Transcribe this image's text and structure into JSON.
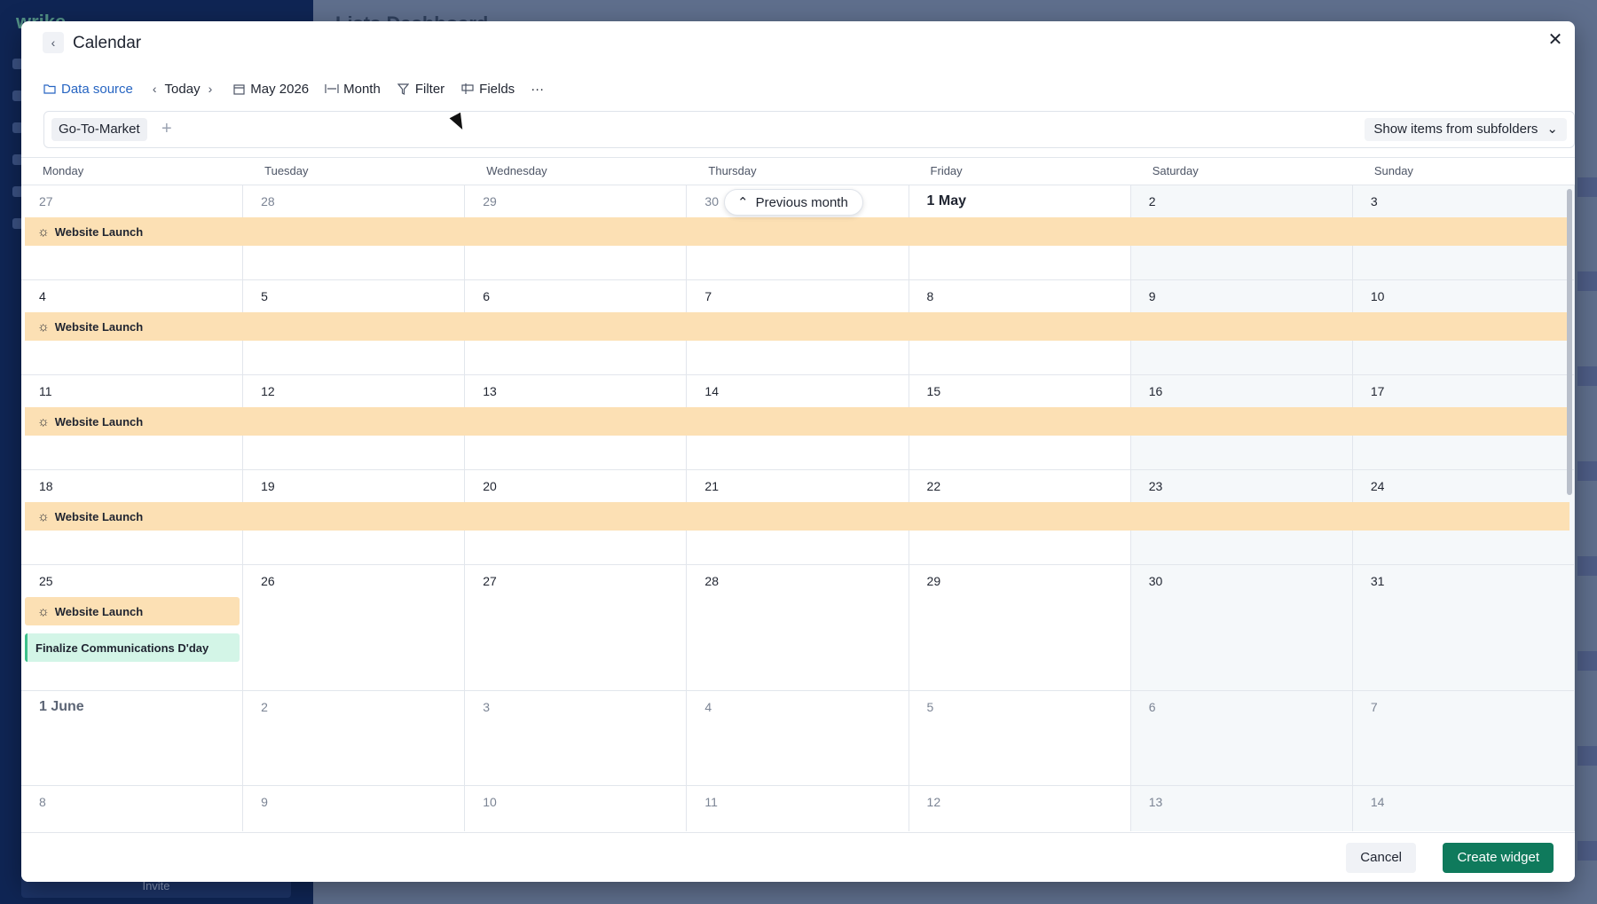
{
  "background": {
    "logo_text": "wrike",
    "page_title": "Lists Dashboard",
    "invite_label": "Invite"
  },
  "modal": {
    "title": "Calendar",
    "toolbar": {
      "data_source": "Data source",
      "today": "Today",
      "period": "May 2026",
      "view": "Month",
      "filter": "Filter",
      "fields": "Fields",
      "more": "···"
    },
    "folder_chip": "Go-To-Market",
    "subfolders_label": "Show items from subfolders",
    "prev_month_label": "Previous month",
    "cancel_label": "Cancel",
    "create_label": "Create widget"
  },
  "calendar": {
    "weekdays": [
      "Monday",
      "Tuesday",
      "Wednesday",
      "Thursday",
      "Friday",
      "Saturday",
      "Sunday"
    ],
    "weeks": [
      [
        "27",
        "28",
        "29",
        "30",
        "1 May",
        "2",
        "3"
      ],
      [
        "4",
        "5",
        "6",
        "7",
        "8",
        "9",
        "10"
      ],
      [
        "11",
        "12",
        "13",
        "14",
        "15",
        "16",
        "17"
      ],
      [
        "18",
        "19",
        "20",
        "21",
        "22",
        "23",
        "24"
      ],
      [
        "25",
        "26",
        "27",
        "28",
        "29",
        "30",
        "31"
      ],
      [
        "1 June",
        "2",
        "3",
        "4",
        "5",
        "6",
        "7"
      ],
      [
        "8",
        "9",
        "10",
        "11",
        "12",
        "13",
        "14"
      ]
    ],
    "events": [
      {
        "week": 0,
        "label": "Website Launch",
        "icon": "sun-icon"
      },
      {
        "week": 1,
        "label": "Website Launch",
        "icon": "sun-icon"
      },
      {
        "week": 2,
        "label": "Website Launch",
        "icon": "sun-icon"
      },
      {
        "week": 3,
        "label": "Website Launch",
        "icon": "sun-icon"
      },
      {
        "week": 4,
        "label": "Website Launch",
        "icon": "sun-icon"
      },
      {
        "week": 4,
        "label": "Finalize Communications D'day"
      }
    ],
    "colors": {
      "event_orange": "#fce0b4",
      "event_green": "#d3f5e7",
      "accent_green": "#0f7a5c",
      "link_blue": "#2765c2"
    }
  }
}
